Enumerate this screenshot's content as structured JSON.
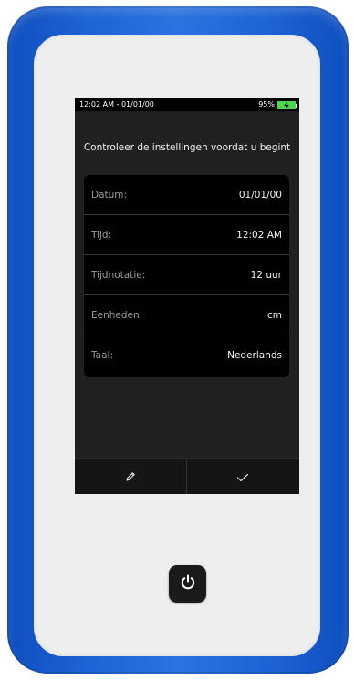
{
  "status_bar": {
    "datetime": "12:02 AM - 01/01/00",
    "battery_percent": "95%",
    "battery_icon": "battery-charging-icon",
    "battery_level": 0.95
  },
  "prompt": "Controleer de instellingen voordat u begint",
  "settings": [
    {
      "label": "Datum:",
      "value": "01/01/00"
    },
    {
      "label": "Tijd:",
      "value": "12:02 AM"
    },
    {
      "label": "Tijdnotatie:",
      "value": "12 uur"
    },
    {
      "label": "Eenheden:",
      "value": "cm"
    },
    {
      "label": "Taal:",
      "value": "Nederlands"
    }
  ],
  "bottom_bar": {
    "edit_icon": "pencil-icon",
    "confirm_icon": "checkmark-icon"
  },
  "device": {
    "power_icon": "power-icon",
    "shell_color": "#1f64d6"
  }
}
